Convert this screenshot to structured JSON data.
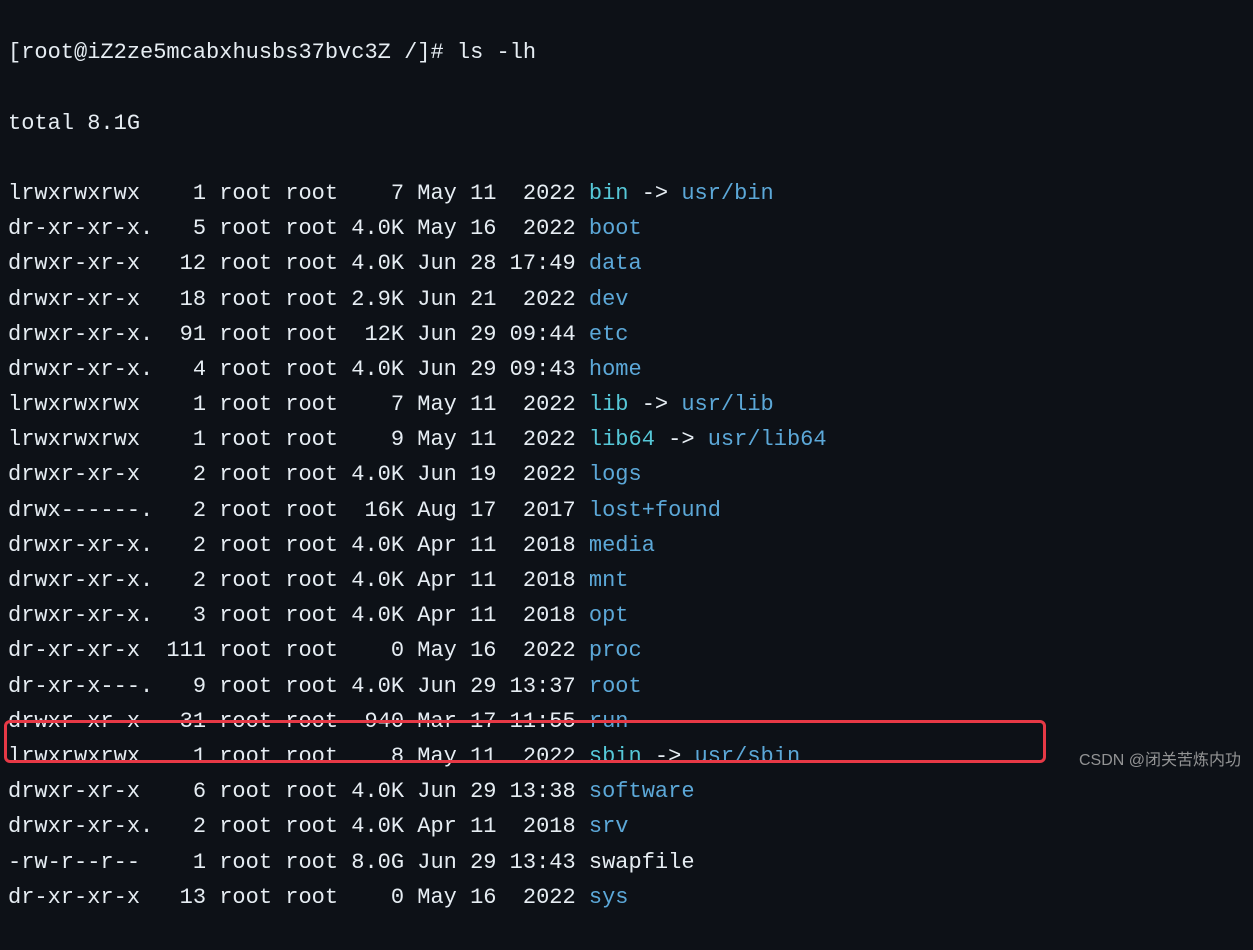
{
  "prompt": {
    "user": "root",
    "host": "iZ2ze5mcabxhusbs37bvc3Z",
    "path": "/",
    "symbol": "#",
    "command": "ls -lh"
  },
  "total": "total 8.1G",
  "entries": [
    {
      "perm": "lrwxrwxrwx ",
      "n": "  1",
      "own": "root",
      "grp": "root",
      "sz": "   7",
      "mon": "May",
      "day": "11",
      "tm": " 2022",
      "name": "bin",
      "link": "usr/bin",
      "color": "cyan"
    },
    {
      "perm": "dr-xr-xr-x.",
      "n": "  5",
      "own": "root",
      "grp": "root",
      "sz": "4.0K",
      "mon": "May",
      "day": "16",
      "tm": " 2022",
      "name": "boot",
      "color": "blue"
    },
    {
      "perm": "drwxr-xr-x ",
      "n": " 12",
      "own": "root",
      "grp": "root",
      "sz": "4.0K",
      "mon": "Jun",
      "day": "28",
      "tm": "17:49",
      "name": "data",
      "color": "blue"
    },
    {
      "perm": "drwxr-xr-x ",
      "n": " 18",
      "own": "root",
      "grp": "root",
      "sz": "2.9K",
      "mon": "Jun",
      "day": "21",
      "tm": " 2022",
      "name": "dev",
      "color": "blue"
    },
    {
      "perm": "drwxr-xr-x.",
      "n": " 91",
      "own": "root",
      "grp": "root",
      "sz": " 12K",
      "mon": "Jun",
      "day": "29",
      "tm": "09:44",
      "name": "etc",
      "color": "blue"
    },
    {
      "perm": "drwxr-xr-x.",
      "n": "  4",
      "own": "root",
      "grp": "root",
      "sz": "4.0K",
      "mon": "Jun",
      "day": "29",
      "tm": "09:43",
      "name": "home",
      "color": "blue"
    },
    {
      "perm": "lrwxrwxrwx ",
      "n": "  1",
      "own": "root",
      "grp": "root",
      "sz": "   7",
      "mon": "May",
      "day": "11",
      "tm": " 2022",
      "name": "lib",
      "link": "usr/lib",
      "color": "cyan"
    },
    {
      "perm": "lrwxrwxrwx ",
      "n": "  1",
      "own": "root",
      "grp": "root",
      "sz": "   9",
      "mon": "May",
      "day": "11",
      "tm": " 2022",
      "name": "lib64",
      "link": "usr/lib64",
      "color": "cyan"
    },
    {
      "perm": "drwxr-xr-x ",
      "n": "  2",
      "own": "root",
      "grp": "root",
      "sz": "4.0K",
      "mon": "Jun",
      "day": "19",
      "tm": " 2022",
      "name": "logs",
      "color": "blue"
    },
    {
      "perm": "drwx------.",
      "n": "  2",
      "own": "root",
      "grp": "root",
      "sz": " 16K",
      "mon": "Aug",
      "day": "17",
      "tm": " 2017",
      "name": "lost+found",
      "color": "blue"
    },
    {
      "perm": "drwxr-xr-x.",
      "n": "  2",
      "own": "root",
      "grp": "root",
      "sz": "4.0K",
      "mon": "Apr",
      "day": "11",
      "tm": " 2018",
      "name": "media",
      "color": "blue"
    },
    {
      "perm": "drwxr-xr-x.",
      "n": "  2",
      "own": "root",
      "grp": "root",
      "sz": "4.0K",
      "mon": "Apr",
      "day": "11",
      "tm": " 2018",
      "name": "mnt",
      "color": "blue"
    },
    {
      "perm": "drwxr-xr-x.",
      "n": "  3",
      "own": "root",
      "grp": "root",
      "sz": "4.0K",
      "mon": "Apr",
      "day": "11",
      "tm": " 2018",
      "name": "opt",
      "color": "blue"
    },
    {
      "perm": "dr-xr-xr-x ",
      "n": "111",
      "own": "root",
      "grp": "root",
      "sz": "   0",
      "mon": "May",
      "day": "16",
      "tm": " 2022",
      "name": "proc",
      "color": "blue"
    },
    {
      "perm": "dr-xr-x---.",
      "n": "  9",
      "own": "root",
      "grp": "root",
      "sz": "4.0K",
      "mon": "Jun",
      "day": "29",
      "tm": "13:37",
      "name": "root",
      "color": "blue"
    },
    {
      "perm": "drwxr-xr-x ",
      "n": " 31",
      "own": "root",
      "grp": "root",
      "sz": " 940",
      "mon": "Mar",
      "day": "17",
      "tm": "11:55",
      "name": "run",
      "color": "blue"
    },
    {
      "perm": "lrwxrwxrwx ",
      "n": "  1",
      "own": "root",
      "grp": "root",
      "sz": "   8",
      "mon": "May",
      "day": "11",
      "tm": " 2022",
      "name": "sbin",
      "link": "usr/sbin",
      "color": "cyan"
    },
    {
      "perm": "drwxr-xr-x ",
      "n": "  6",
      "own": "root",
      "grp": "root",
      "sz": "4.0K",
      "mon": "Jun",
      "day": "29",
      "tm": "13:38",
      "name": "software",
      "color": "blue"
    },
    {
      "perm": "drwxr-xr-x.",
      "n": "  2",
      "own": "root",
      "grp": "root",
      "sz": "4.0K",
      "mon": "Apr",
      "day": "11",
      "tm": " 2018",
      "name": "srv",
      "color": "blue"
    },
    {
      "perm": "-rw-r--r-- ",
      "n": "  1",
      "own": "root",
      "grp": "root",
      "sz": "8.0G",
      "mon": "Jun",
      "day": "29",
      "tm": "13:43",
      "name": "swapfile",
      "color": "white"
    },
    {
      "perm": "dr-xr-xr-x ",
      "n": " 13",
      "own": "root",
      "grp": "root",
      "sz": "   0",
      "mon": "May",
      "day": "16",
      "tm": " 2022",
      "name": "sys",
      "color": "blue"
    }
  ],
  "arrow": " -> ",
  "watermark": "CSDN @闭关苦炼内功"
}
